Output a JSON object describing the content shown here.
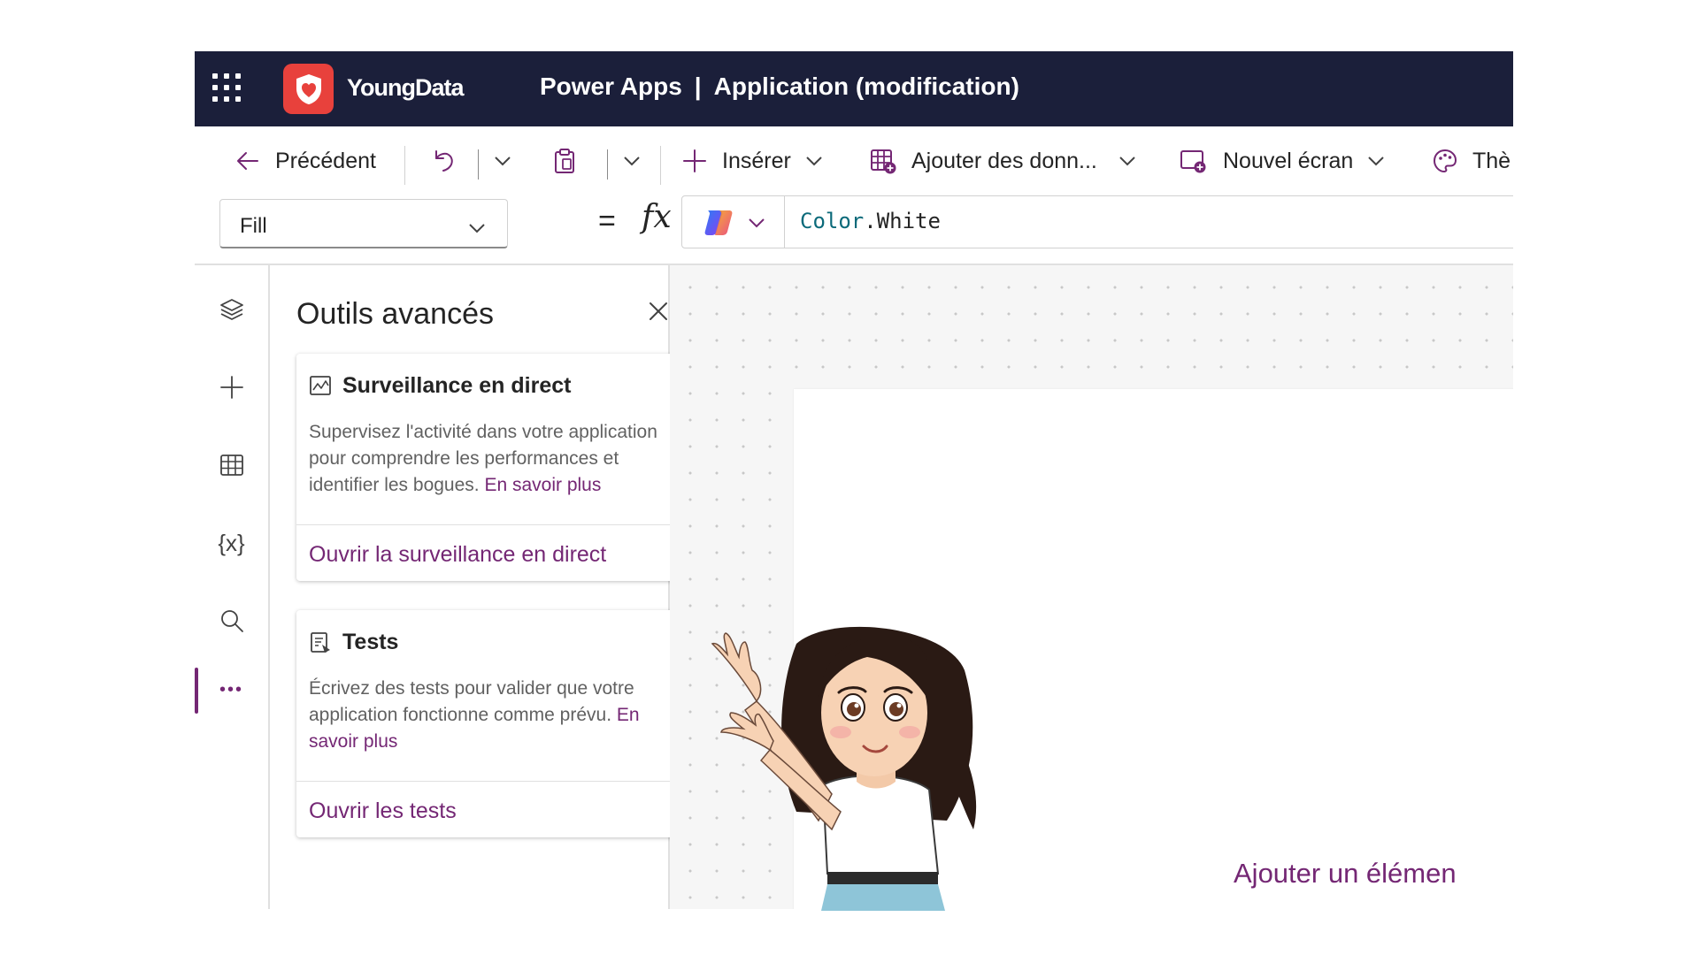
{
  "header": {
    "brand": "YoungData",
    "product": "Power Apps",
    "separator": "|",
    "app_title": "Application (modification)"
  },
  "commandbar": {
    "back_label": "Précédent",
    "insert_label": "Insérer",
    "add_data_label": "Ajouter des donn...",
    "new_screen_label": "Nouvel écran",
    "theme_label": "Thè"
  },
  "formula": {
    "property_value": "Fill",
    "equals": "=",
    "fx": "fx",
    "expr_object": "Color",
    "expr_dot": ".",
    "expr_member": "White"
  },
  "panel": {
    "title": "Outils avancés",
    "cards": [
      {
        "title": "Surveillance en direct",
        "description": "Supervisez l'activité dans votre application pour comprendre les performances et identifier les bogues.",
        "learn_more": "En savoir plus",
        "action": "Ouvrir la surveillance en direct",
        "icon": "monitor-chart-icon"
      },
      {
        "title": "Tests",
        "description": "Écrivez des tests pour valider que votre application fonctionne comme prévu.",
        "learn_more": "En savoir plus",
        "action": "Ouvrir les tests",
        "icon": "test-clipboard-icon"
      }
    ]
  },
  "rail": {
    "items": [
      "layers-icon",
      "add-icon",
      "data-table-icon",
      "variables-icon",
      "search-icon",
      "more-icon"
    ],
    "variables_glyph": "{x}",
    "more_glyph": "•••"
  },
  "canvas": {
    "add_element_text": "Ajouter un élémen"
  },
  "colors": {
    "header_bg": "#1b1f3a",
    "accent": "#742774",
    "logo_bg": "#e8413c"
  }
}
